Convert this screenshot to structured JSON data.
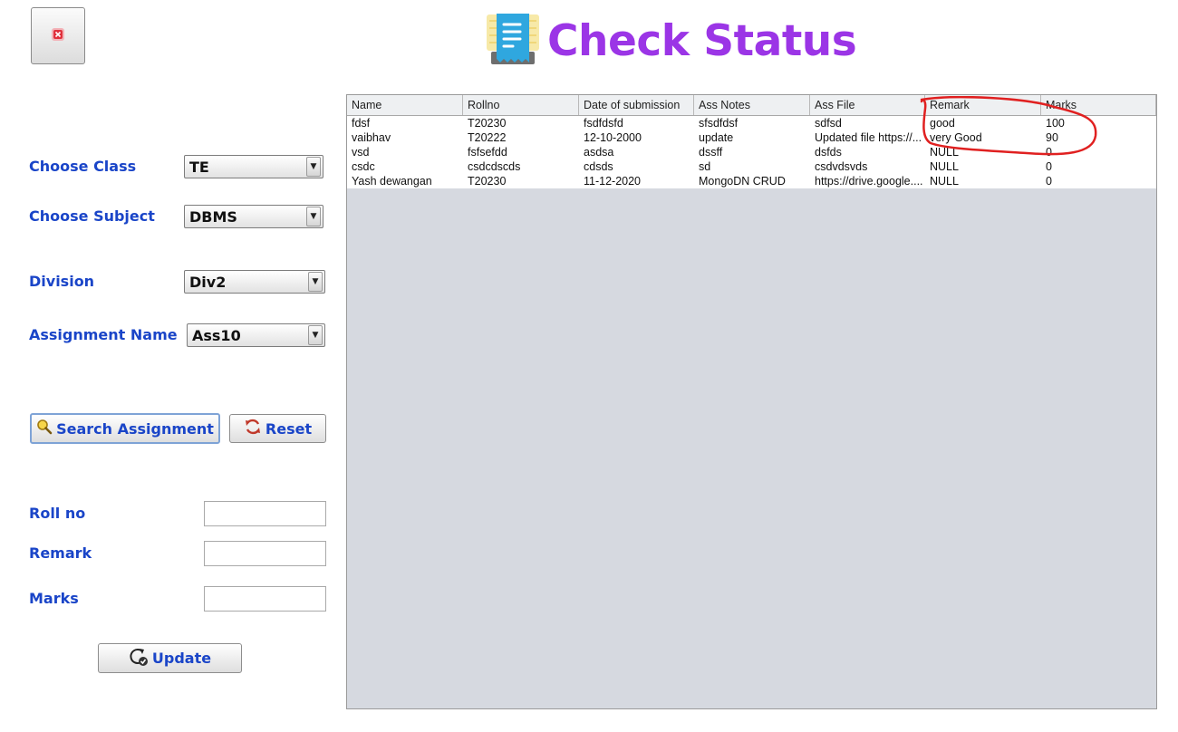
{
  "header": {
    "title": "Check Status",
    "title_color": "#9b35e6",
    "close_icon": "close-icon",
    "title_icon": "receipt-icon"
  },
  "form": {
    "choose_class_label": "Choose Class",
    "choose_class_value": "TE",
    "choose_subject_label": "Choose Subject",
    "choose_subject_value": "DBMS",
    "division_label": "Division",
    "division_value": "Div2",
    "assignment_name_label": "Assignment Name",
    "assignment_name_value": "Ass10",
    "label_color": "#1a45c8"
  },
  "actions": {
    "search_label": "Search Assignment",
    "search_icon": "magnifier-icon",
    "reset_label": "Reset",
    "reset_icon": "refresh-icon",
    "update_label": "Update",
    "update_icon": "update-icon"
  },
  "edit": {
    "rollno_label": "Roll no",
    "rollno_value": "",
    "remark_label": "Remark",
    "remark_value": "",
    "marks_label": "Marks",
    "marks_value": ""
  },
  "table": {
    "columns": [
      "Name",
      "Rollno",
      "Date of submission",
      "Ass Notes",
      "Ass File",
      "Remark",
      "Marks"
    ],
    "rows": [
      [
        "fdsf",
        "T20230",
        "fsdfdsfd",
        "sfsdfdsf",
        "sdfsd",
        "good",
        "100"
      ],
      [
        "vaibhav",
        "T20222",
        "12-10-2000",
        "update",
        "Updated file https://...",
        "very Good",
        "90"
      ],
      [
        "vsd",
        "fsfsefdd",
        "asdsa",
        "dssff",
        "dsfds",
        "NULL",
        "0"
      ],
      [
        "csdc",
        "csdcdscds",
        "cdsds",
        "sd",
        "csdvdsvds",
        "NULL",
        "0"
      ],
      [
        "Yash dewangan",
        "T20230",
        "11-12-2020",
        "MongoDN CRUD",
        "https://drive.google....",
        "NULL",
        "0"
      ]
    ],
    "annotation_color": "#e02020"
  }
}
